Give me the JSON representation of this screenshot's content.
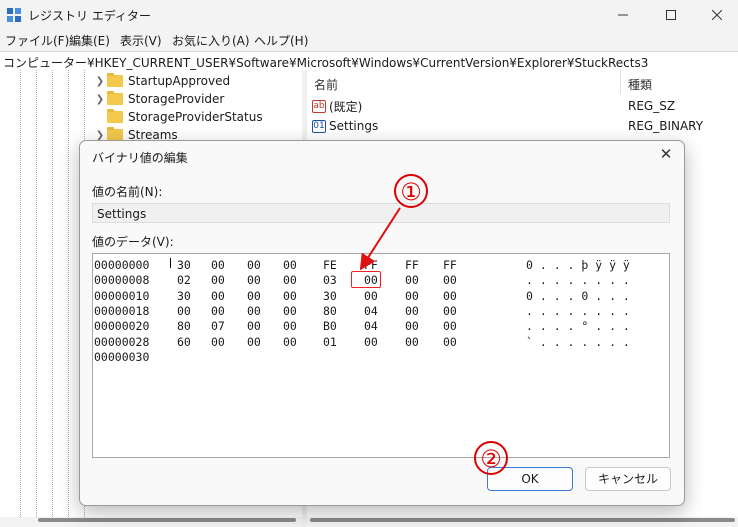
{
  "window": {
    "title": "レジストリ エディター"
  },
  "menu": [
    "ファイル(F)",
    "編集(E)",
    "表示(V)",
    "お気に入り(A)",
    "ヘルプ(H)"
  ],
  "address": "コンピューター¥HKEY_CURRENT_USER¥Software¥Microsoft¥Windows¥CurrentVersion¥Explorer¥StuckRects3",
  "tree": {
    "items": [
      {
        "label": "StartupApproved",
        "expandable": true
      },
      {
        "label": "StorageProvider",
        "expandable": true
      },
      {
        "label": "StorageProviderStatus",
        "expandable": false
      },
      {
        "label": "Streams",
        "expandable": true
      }
    ]
  },
  "values_pane": {
    "headers": {
      "name": "名前",
      "type": "種類"
    },
    "rows": [
      {
        "icon": "string-value-icon",
        "icon_text": "ab",
        "name": "(既定)",
        "type": "REG_SZ"
      },
      {
        "icon": "binary-value-icon",
        "icon_text": "01",
        "name": "Settings",
        "type": "REG_BINARY"
      }
    ]
  },
  "dialog": {
    "title": "バイナリ値の編集",
    "value_name_label": "値の名前(N):",
    "value_name": "Settings",
    "value_data_label": "値のデータ(V):",
    "hex_rows": [
      {
        "addr": "00000000",
        "bytes": [
          "30",
          "00",
          "00",
          "00",
          "FE",
          "FF",
          "FF",
          "FF"
        ],
        "ascii": "0 . . . þ ÿ ÿ ÿ"
      },
      {
        "addr": "00000008",
        "bytes": [
          "02",
          "00",
          "00",
          "00",
          "03",
          "00",
          "00",
          "00"
        ],
        "ascii": ". . . . . . . ."
      },
      {
        "addr": "00000010",
        "bytes": [
          "30",
          "00",
          "00",
          "00",
          "30",
          "00",
          "00",
          "00"
        ],
        "ascii": "0 . . . 0 . . ."
      },
      {
        "addr": "00000018",
        "bytes": [
          "00",
          "00",
          "00",
          "00",
          "80",
          "04",
          "00",
          "00"
        ],
        "ascii": ". . . . . . . ."
      },
      {
        "addr": "00000020",
        "bytes": [
          "80",
          "07",
          "00",
          "00",
          "B0",
          "04",
          "00",
          "00"
        ],
        "ascii": ". . . . ° . . ."
      },
      {
        "addr": "00000028",
        "bytes": [
          "60",
          "00",
          "00",
          "00",
          "01",
          "00",
          "00",
          "00"
        ],
        "ascii": "` . . . . . . ."
      },
      {
        "addr": "00000030",
        "bytes": [],
        "ascii": ""
      }
    ],
    "ok_label": "OK",
    "cancel_label": "キャンセル"
  },
  "annotations": {
    "marker1": "①",
    "marker2": "②",
    "color": "#dd1111"
  }
}
